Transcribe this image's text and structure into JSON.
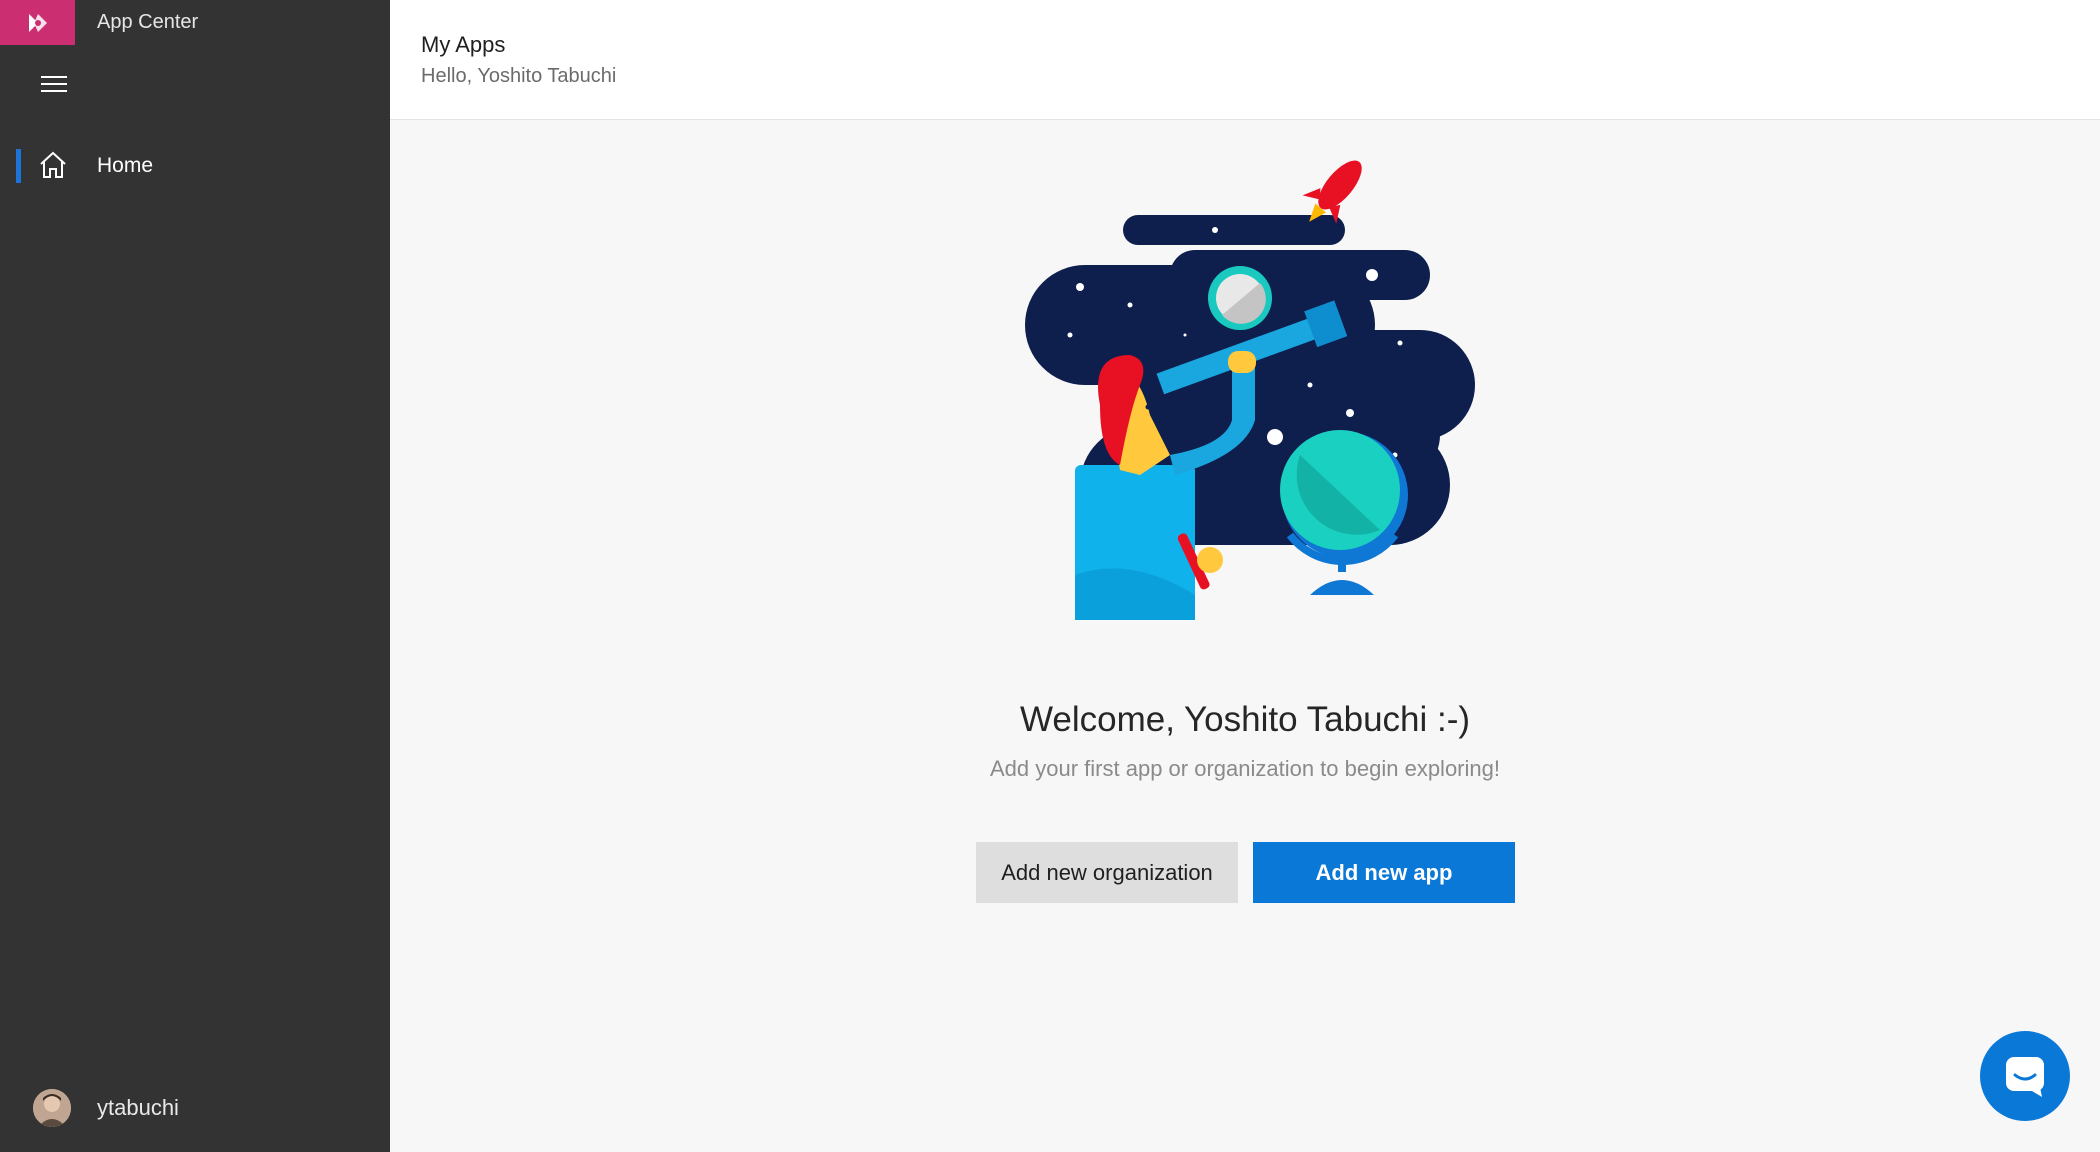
{
  "sidebar": {
    "brand_name": "App Center",
    "menu_icon": "hamburger-menu-icon",
    "nav": [
      {
        "label": "Home",
        "icon": "home-icon",
        "active": true
      }
    ],
    "user": {
      "username": "ytabuchi"
    }
  },
  "header": {
    "title": "My Apps",
    "subtitle": "Hello, Yoshito Tabuchi"
  },
  "main": {
    "welcome_title": "Welcome, Yoshito Tabuchi :-)",
    "welcome_subtitle": "Add your first app or organization to begin exploring!",
    "buttons": {
      "add_organization": "Add new organization",
      "add_app": "Add new app"
    }
  },
  "colors": {
    "sidebar_bg": "#333333",
    "brand_accent": "#cc2e72",
    "primary_button": "#0a78d7",
    "active_indicator": "#1d74d6"
  }
}
